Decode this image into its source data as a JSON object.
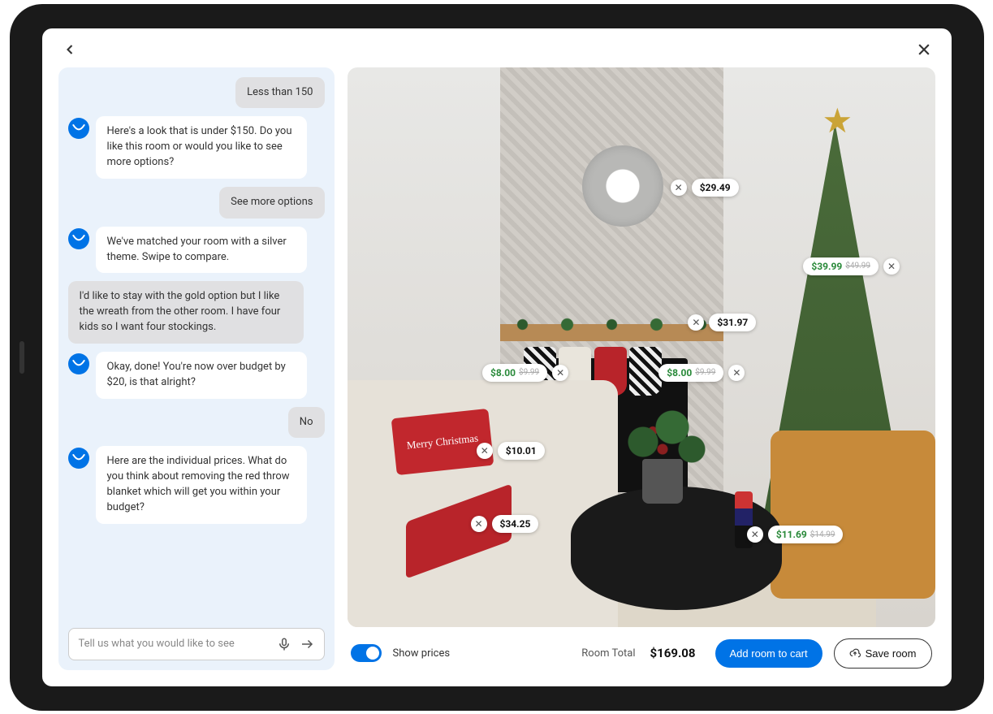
{
  "chat": {
    "messages": [
      {
        "role": "user",
        "text": "Less than 150"
      },
      {
        "role": "assistant",
        "text": "Here's a look that is under $150. Do you like this room or would you like to see more options?"
      },
      {
        "role": "user",
        "text": "See more options"
      },
      {
        "role": "assistant",
        "text": "We've matched your room with a silver theme. Swipe to compare."
      },
      {
        "role": "neutral",
        "text": "I'd like to stay with the gold option but I like the wreath from the other room. I have four kids so I want four stockings."
      },
      {
        "role": "assistant",
        "text": "Okay, done! You're now over budget by $20, is that alright?"
      },
      {
        "role": "user",
        "text": "No"
      },
      {
        "role": "assistant",
        "text": "Here are the individual prices. What do you think about removing the red throw blanket which will get you within your budget?"
      }
    ],
    "input_placeholder": "Tell us what you would like to see"
  },
  "room": {
    "pillow_text": "Merry Christmas",
    "tags": {
      "wreath": {
        "price": "$29.49"
      },
      "garland": {
        "price": "$31.97"
      },
      "stocking_l": {
        "price": "$8.00",
        "old": "$9.99",
        "sale": true
      },
      "stocking_r": {
        "price": "$8.00",
        "old": "$9.99",
        "sale": true
      },
      "tree": {
        "price": "$39.99",
        "old": "$49.99",
        "sale": true
      },
      "pillow": {
        "price": "$10.01"
      },
      "throw": {
        "price": "$34.25"
      },
      "nutcracker": {
        "price": "$11.69",
        "old": "$14.99",
        "sale": true
      }
    },
    "footer": {
      "show_prices_label": "Show prices",
      "total_label": "Room Total",
      "total_value": "$169.08",
      "add_to_cart": "Add room to cart",
      "save_room": "Save room"
    }
  }
}
